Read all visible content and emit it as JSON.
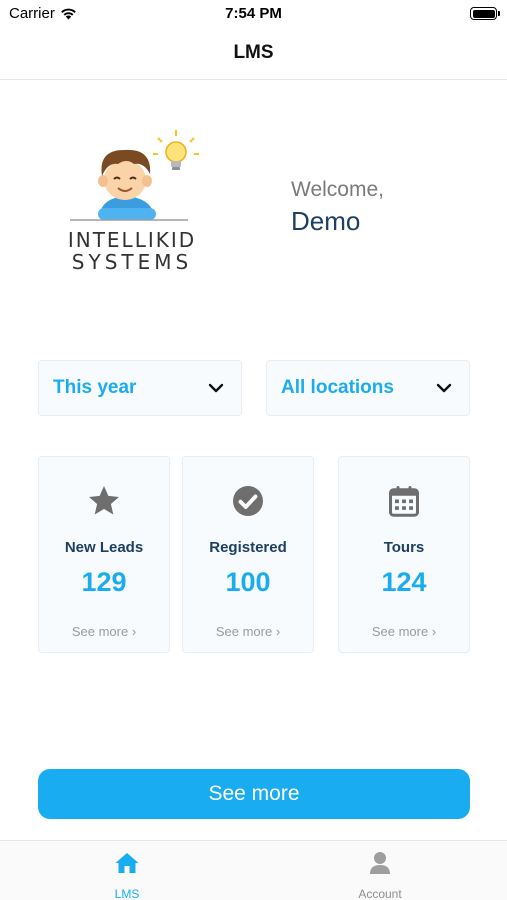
{
  "status_bar": {
    "carrier": "Carrier",
    "time": "7:54 PM"
  },
  "nav": {
    "title": "LMS"
  },
  "logo": {
    "line1": "INTELLIKID",
    "line2": "SYSTEMS"
  },
  "welcome": {
    "label": "Welcome,",
    "name": "Demo"
  },
  "filters": {
    "period": {
      "selected": "This year"
    },
    "location": {
      "selected": "All locations"
    }
  },
  "cards": [
    {
      "title": "New Leads",
      "count": "129",
      "link": "See more ›",
      "icon": "star-icon"
    },
    {
      "title": "Registered",
      "count": "100",
      "link": "See more ›",
      "icon": "check-circle-icon"
    },
    {
      "title": "Tours",
      "count": "124",
      "link": "See more ›",
      "icon": "calendar-icon"
    }
  ],
  "see_more_button": "See more",
  "tabs": [
    {
      "label": "LMS",
      "icon": "home-icon",
      "active": true
    },
    {
      "label": "Account",
      "icon": "person-icon",
      "active": false
    }
  ],
  "colors": {
    "accent": "#1aacf0",
    "heading": "#1d3f63",
    "muted": "#9a9a9a",
    "card_bg": "#f8fbfe"
  }
}
